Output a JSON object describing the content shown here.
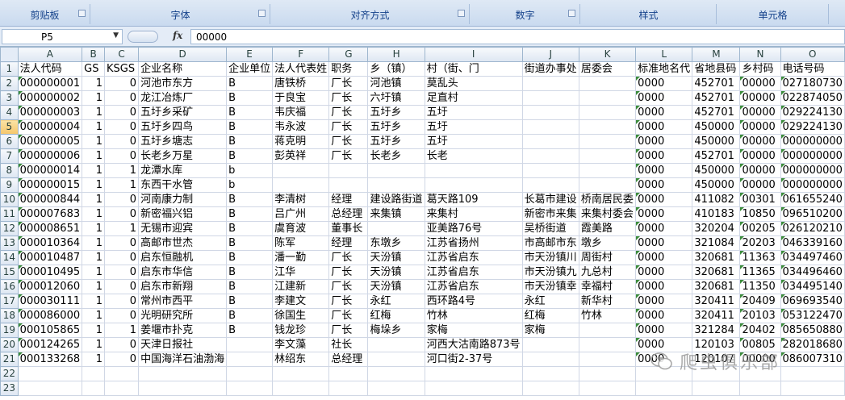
{
  "ribbon": {
    "groups": [
      "剪贴板",
      "字体",
      "对齐方式",
      "数字",
      "样式",
      "单元格"
    ]
  },
  "formula_bar": {
    "name_box": "P5",
    "formula_value": "00000"
  },
  "columns": [
    "A",
    "B",
    "C",
    "D",
    "E",
    "F",
    "G",
    "H",
    "I",
    "J",
    "K",
    "L",
    "M",
    "N",
    "O"
  ],
  "rows": [
    {
      "n": "1",
      "cells": [
        "法人代码",
        "GS",
        "KSGS",
        "企业名称",
        "企业单位",
        "法人代表姓",
        "职务",
        "乡（镇）",
        "村（街、门",
        "街道办事处",
        "居委会",
        "标准地名代",
        "省地县码",
        "乡村码",
        "电话号码"
      ]
    },
    {
      "n": "2",
      "cells": [
        "000000001",
        "1",
        "0",
        "河池市东方",
        "B",
        "唐铁桥",
        "厂长",
        "河池镇",
        "莫乱头",
        "",
        "",
        "0000",
        "452701",
        "00000",
        "027180730"
      ]
    },
    {
      "n": "3",
      "cells": [
        "000000002",
        "1",
        "0",
        "龙江冶炼厂",
        "B",
        "于良宝",
        "厂长",
        "六圩镇",
        "足直村",
        "",
        "",
        "0000",
        "452701",
        "00000",
        "022874050"
      ]
    },
    {
      "n": "4",
      "cells": [
        "000000003",
        "1",
        "0",
        "五圩乡采矿",
        "B",
        "韦庆福",
        "厂长",
        "五圩乡",
        "五圩",
        "",
        "",
        "0000",
        "452701",
        "00000",
        "029224130"
      ]
    },
    {
      "n": "5",
      "cells": [
        "000000004",
        "1",
        "0",
        "五圩乡四鸟",
        "B",
        "韦永波",
        "厂长",
        "五圩乡",
        "五圩",
        "",
        "",
        "0000",
        "450000",
        "00000",
        "029224130"
      ]
    },
    {
      "n": "6",
      "cells": [
        "000000005",
        "1",
        "0",
        "五圩乡塘志",
        "B",
        "蒋克明",
        "厂长",
        "五圩乡",
        "五圩",
        "",
        "",
        "0000",
        "450000",
        "00000",
        "000000000"
      ]
    },
    {
      "n": "7",
      "cells": [
        "000000006",
        "1",
        "0",
        "长老乡万星",
        "B",
        "彭英祥",
        "厂长",
        "长老乡",
        "长老",
        "",
        "",
        "0000",
        "452701",
        "00000",
        "000000000"
      ]
    },
    {
      "n": "8",
      "cells": [
        "000000014",
        "1",
        "1",
        "龙潭水库",
        "b",
        "",
        "",
        "",
        "",
        "",
        "",
        "0000",
        "450000",
        "00000",
        "000000000"
      ]
    },
    {
      "n": "9",
      "cells": [
        "000000015",
        "1",
        "1",
        "东西干水管",
        "b",
        "",
        "",
        "",
        "",
        "",
        "",
        "0000",
        "450000",
        "00000",
        "000000000"
      ]
    },
    {
      "n": "10",
      "cells": [
        "000000844",
        "1",
        "0",
        "河南康力制",
        "B",
        "李清树",
        "经理",
        "建设路街道",
        "葛天路109",
        "长葛市建设",
        "桥南居民委",
        "0000",
        "411082",
        "00301",
        "061655240"
      ]
    },
    {
      "n": "11",
      "cells": [
        "000007683",
        "1",
        "0",
        "新密福兴铝",
        "B",
        "吕广州",
        "总经理",
        "来集镇",
        "来集村",
        "新密市来集",
        "来集村委会",
        "0000",
        "410183",
        "10850",
        "096510200"
      ]
    },
    {
      "n": "12",
      "cells": [
        "000008651",
        "1",
        "1",
        "无锡市迎宾",
        "B",
        "虞育波",
        "董事长",
        "",
        "亚美路76号",
        "吴桥街道",
        "霞美路",
        "0000",
        "320204",
        "00205",
        "026120210"
      ]
    },
    {
      "n": "13",
      "cells": [
        "000010364",
        "1",
        "0",
        "高邮市世杰",
        "B",
        "陈军",
        "经理",
        "东墩乡",
        "江苏省扬州",
        "市高邮市东",
        "墩乡",
        "0000",
        "321084",
        "20203",
        "046339160"
      ]
    },
    {
      "n": "14",
      "cells": [
        "000010487",
        "1",
        "0",
        "启东恒融机",
        "B",
        "潘一勤",
        "厂长",
        "天汾镇",
        "江苏省启东",
        "市天汾镇川",
        "周街村",
        "0000",
        "320681",
        "11363",
        "034497460"
      ]
    },
    {
      "n": "15",
      "cells": [
        "000010495",
        "1",
        "0",
        "启东市华信",
        "B",
        "江华",
        "厂长",
        "天汾镇",
        "江苏省启东",
        "市天汾镇九",
        "九总村",
        "0000",
        "320681",
        "11365",
        "034496460"
      ]
    },
    {
      "n": "16",
      "cells": [
        "000012060",
        "1",
        "0",
        "启东市新翔",
        "B",
        "江建新",
        "厂长",
        "天汾镇",
        "江苏省启东",
        "市天汾镇幸",
        "幸福村",
        "0000",
        "320681",
        "11350",
        "034495140"
      ]
    },
    {
      "n": "17",
      "cells": [
        "000030111",
        "1",
        "0",
        "常州市西平",
        "B",
        "李建文",
        "厂长",
        "永红",
        "西环路4号",
        "永红",
        "新华村",
        "0000",
        "320411",
        "20409",
        "069693540"
      ]
    },
    {
      "n": "18",
      "cells": [
        "000086000",
        "1",
        "0",
        "光明研究所",
        "B",
        "徐国生",
        "厂长",
        "红梅",
        "竹林",
        "红梅",
        "竹林",
        "0000",
        "320411",
        "20103",
        "053122470"
      ]
    },
    {
      "n": "19",
      "cells": [
        "000105865",
        "1",
        "1",
        "姜堰市扑克",
        "B",
        "钱龙珍",
        "厂长",
        "梅垛乡",
        "家梅",
        "家梅",
        "",
        "0000",
        "321284",
        "20402",
        "085650880"
      ]
    },
    {
      "n": "20",
      "cells": [
        "000124265",
        "1",
        "0",
        "天津日报社",
        "",
        "李文藻",
        "社长",
        "",
        "河西大沽南路873号",
        "",
        "",
        "0000",
        "120103",
        "00805",
        "282018680"
      ]
    },
    {
      "n": "21",
      "cells": [
        "000133268",
        "1",
        "0",
        "中国海洋石油渤海",
        "",
        "林绍东",
        "总经理",
        "",
        "河口街2-37号",
        "",
        "",
        "0000",
        "120107",
        "00000",
        "086007310"
      ]
    },
    {
      "n": "22",
      "cells": [
        "",
        "",
        "",
        "",
        "",
        "",
        "",
        "",
        "",
        "",
        "",
        "",
        "",
        "",
        ""
      ]
    },
    {
      "n": "23",
      "cells": [
        "",
        "",
        "",
        "",
        "",
        "",
        "",
        "",
        "",
        "",
        "",
        "",
        "",
        "",
        ""
      ]
    }
  ],
  "watermark": {
    "text": "爬虫俱乐部"
  }
}
